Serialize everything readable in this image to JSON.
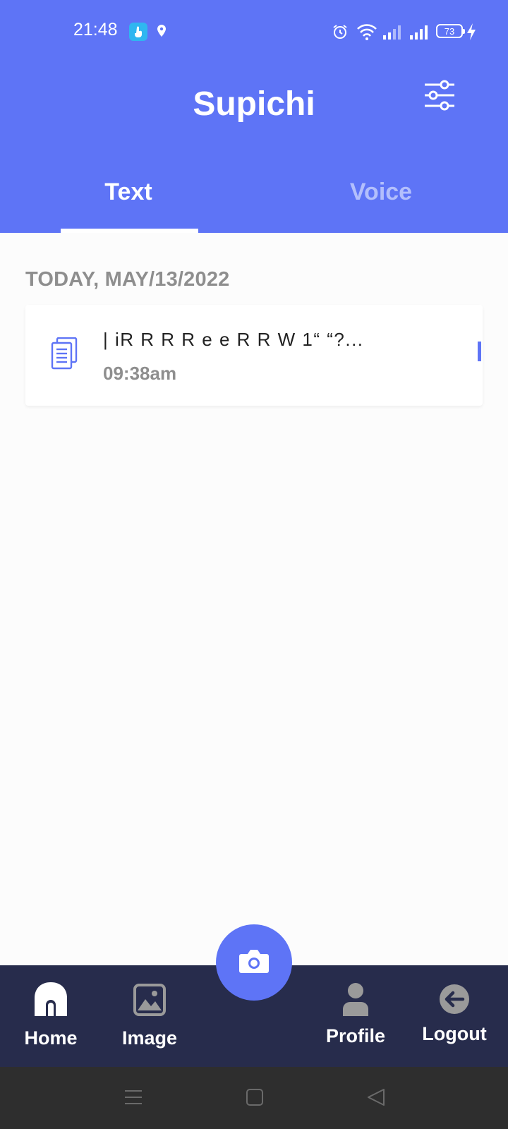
{
  "status_bar": {
    "time": "21:48",
    "battery": "73",
    "icons": [
      "touch-app-icon",
      "location-icon",
      "alarm-icon",
      "wifi-icon",
      "signal-icon",
      "signal-icon",
      "battery-icon",
      "charging-icon"
    ]
  },
  "header": {
    "title": "Supichi",
    "filter_icon": "filter-sliders-icon",
    "color": "#5E74F6"
  },
  "tabs": [
    {
      "label": "Text",
      "active": true
    },
    {
      "label": "Voice",
      "active": false
    }
  ],
  "list": {
    "date_header": "TODAY, MAY/13/2022",
    "items": [
      {
        "title": "| iR R R R e e R R W 1“ “?...",
        "time": "09:38am",
        "icon": "document-icon"
      }
    ]
  },
  "bottom_nav": {
    "items": [
      {
        "label": "Home",
        "icon": "home-icon"
      },
      {
        "label": "Image",
        "icon": "image-icon"
      },
      {
        "label": "Profile",
        "icon": "person-icon"
      },
      {
        "label": "Logout",
        "icon": "logout-arrow-icon"
      }
    ],
    "fab_icon": "camera-icon",
    "background": "#272C4C"
  },
  "system_nav": {
    "icons": [
      "menu-icon",
      "home-square-icon",
      "back-triangle-icon"
    ]
  }
}
